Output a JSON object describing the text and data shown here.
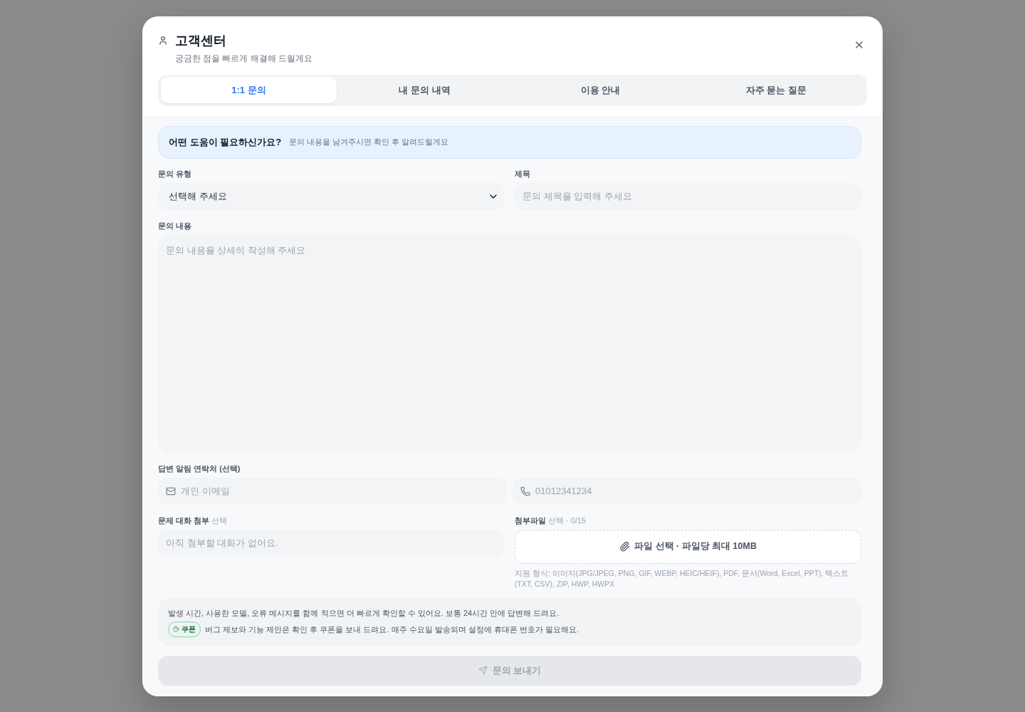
{
  "dialog": {
    "title": "고객센터",
    "subtitle": "궁금한 점을 빠르게 해결해 드릴게요"
  },
  "tabs": [
    {
      "label": "1:1 문의",
      "selected": true
    },
    {
      "label": "내 문의 내역",
      "selected": false
    },
    {
      "label": "이용 안내",
      "selected": false
    },
    {
      "label": "자주 묻는 질문",
      "selected": false
    }
  ],
  "banner": {
    "title": "어떤 도움이 필요하신가요?",
    "text": "문의 내용을 남겨주시면 확인 후 알려드릴게요"
  },
  "form": {
    "inquiry_type": {
      "label": "문의 유형",
      "value": "선택해 주세요"
    },
    "subject": {
      "label": "제목",
      "placeholder": "문의 제목을 입력해 주세요"
    },
    "content": {
      "label": "문의 내용",
      "placeholder": "문의 내용을 상세히 작성해 주세요"
    },
    "contact": {
      "label": "답변 알림 연락처 (선택)",
      "email_placeholder": "개인 이메일",
      "phone_placeholder": "01012341234"
    },
    "conversation": {
      "label": "**문제 대화 첨부** 선택",
      "empty_text": "아직 첨부할 대화가 없어요."
    },
    "attachments": {
      "label": "**첨부파일** 선택 · 0/15",
      "button": "파일 선택 · 파일당 최대 10MB",
      "formats": "지원 형식: 이미지(JPG/JPEG, PNG, GIF, WEBP, HEIC/HEIF), PDF, 문서(Word, Excel, PPT), 텍스트(TXT, CSV), ZIP, HWP, HWPX"
    }
  },
  "notice": {
    "text": "발생 시간, 사용한 모델, 오류 메시지를 함께 적으면 더 빠르게 확인할 수 있어요. 보통 24시간 안에 답변해 드려요.",
    "badge": "쿠폰",
    "badge_text": "버그 제보와 기능 제안은 확인 후 쿠폰을 보내 드려요. 매주 수요일 발송되며 설정에 휴대폰 번호가 필요해요."
  },
  "submit": {
    "label": "문의 보내기",
    "disabled": true
  }
}
